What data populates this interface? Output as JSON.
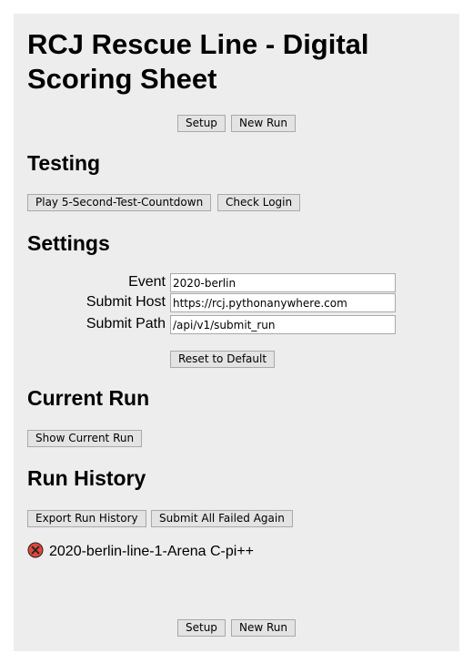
{
  "page": {
    "title": "RCJ Rescue Line - Digital Scoring Sheet"
  },
  "top_nav": {
    "setup_label": "Setup",
    "new_run_label": "New Run"
  },
  "testing": {
    "heading": "Testing",
    "countdown_label": "Play 5-Second-Test-Countdown",
    "check_login_label": "Check Login"
  },
  "settings": {
    "heading": "Settings",
    "event_label": "Event",
    "event_value": "2020-berlin",
    "submit_host_label": "Submit Host",
    "submit_host_value": "https://rcj.pythonanywhere.com",
    "submit_path_label": "Submit Path",
    "submit_path_value": "/api/v1/submit_run",
    "reset_label": "Reset to Default"
  },
  "current_run": {
    "heading": "Current Run",
    "show_label": "Show Current Run"
  },
  "run_history": {
    "heading": "Run History",
    "export_label": "Export Run History",
    "submit_failed_label": "Submit All Failed Again",
    "items": [
      {
        "status_icon": "failed-icon",
        "status_color": "#e0463a",
        "label": "2020-berlin-line-1-Arena C-pi++"
      }
    ]
  },
  "bottom_nav": {
    "setup_label": "Setup",
    "new_run_label": "New Run"
  }
}
